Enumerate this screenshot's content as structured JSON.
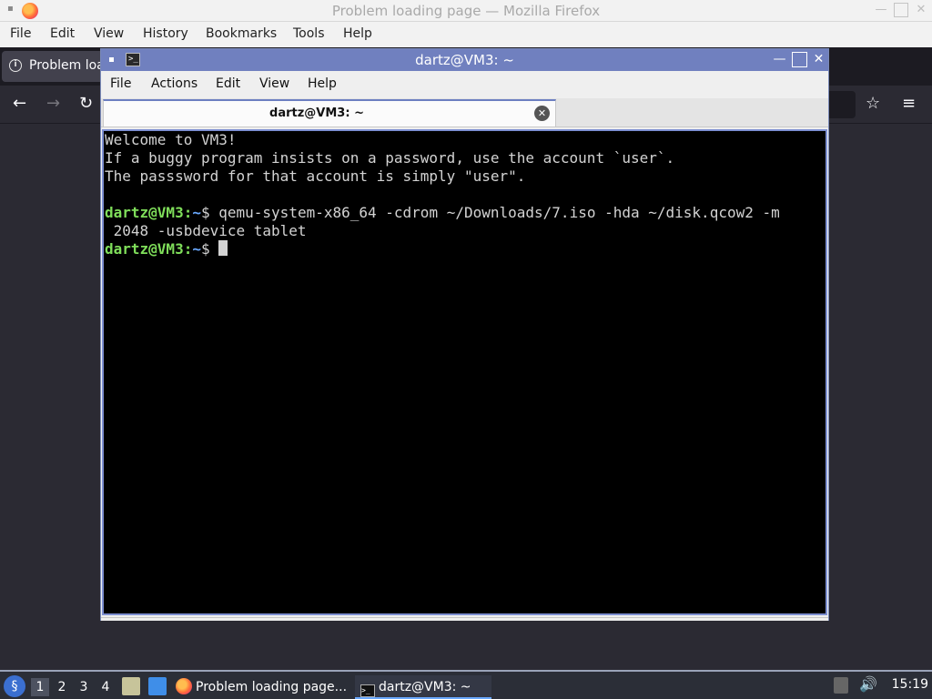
{
  "firefox": {
    "window_title": "Problem loading page — Mozilla Firefox",
    "menu": [
      "File",
      "Edit",
      "View",
      "History",
      "Bookmarks",
      "Tools",
      "Help"
    ],
    "tab_label": "Problem loa"
  },
  "terminal": {
    "window_title": "dartz@VM3: ~",
    "menu": [
      "File",
      "Actions",
      "Edit",
      "View",
      "Help"
    ],
    "tab_label": "dartz@VM3: ~",
    "lines": [
      "Welcome to VM3!",
      "If a buggy program insists on a password, use the account `user`.",
      "The passsword for that account is simply \"user\"."
    ],
    "prompt_user": "dartz@VM3",
    "prompt_sep": ":",
    "prompt_path": "~",
    "prompt_symbol": "$ ",
    "command_line1": "qemu-system-x86_64 -cdrom ~/Downloads/7.iso -hda ~/disk.qcow2 -m",
    "command_line2": " 2048 -usbdevice tablet"
  },
  "taskbar": {
    "workspaces": [
      "1",
      "2",
      "3",
      "4"
    ],
    "task_firefox": "Problem loading page...",
    "task_terminal": "dartz@VM3: ~",
    "clock": "15:19"
  },
  "colors": {
    "terminal_titlebar": "#7080bf",
    "prompt_user": "#7fde5a",
    "prompt_path": "#6aa9ff",
    "firefox_dark": "#2b2a33"
  }
}
